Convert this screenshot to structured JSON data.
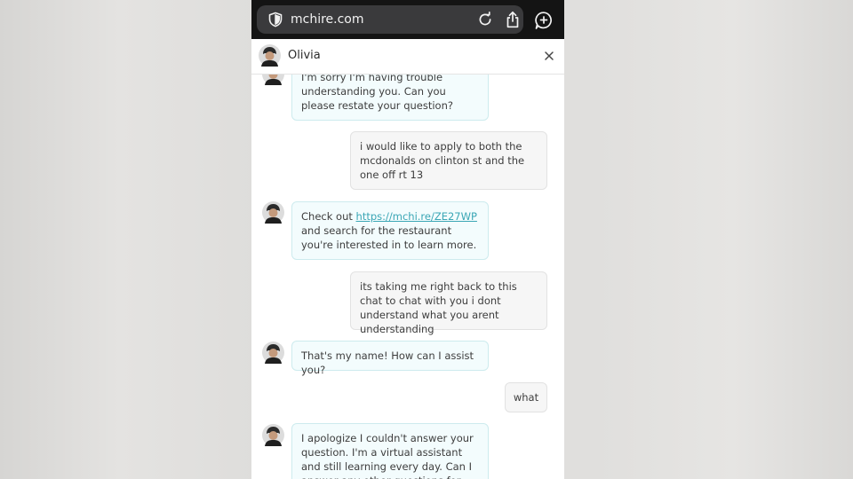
{
  "browser": {
    "url": "mchire.com",
    "icons": [
      "shield-icon",
      "reload-icon",
      "share-icon",
      "chat-plus-icon"
    ]
  },
  "chat": {
    "agent_name": "Olivia",
    "close_icon": "close-icon",
    "messages": [
      {
        "from": "bot",
        "text": "I'm sorry I'm having trouble understanding you. Can you please restate your question?"
      },
      {
        "from": "user",
        "text": "i would like to apply to both the mcdonalds on clinton st and the one off rt 13"
      },
      {
        "from": "bot",
        "pre": "Check out ",
        "link": "https://mchi.re/ZE27WP",
        "post": " and search for the restaurant you're interested in to learn more."
      },
      {
        "from": "user",
        "text": "its taking me right back to this chat to chat with you i dont understand what you arent understanding"
      },
      {
        "from": "bot",
        "text": "That's my name! How can I assist you?"
      },
      {
        "from": "user",
        "text": "what"
      },
      {
        "from": "bot",
        "text": "I apologize I couldn't answer your question. I'm a virtual assistant and still learning every day. Can I answer any other questions for you?"
      }
    ]
  },
  "colors": {
    "accent_link": "#3aa6b5",
    "bot_bubble": "#f3fcfd",
    "bot_border": "#cdebee",
    "user_bubble": "#f6f6f6",
    "browser_bar": "#141414"
  }
}
